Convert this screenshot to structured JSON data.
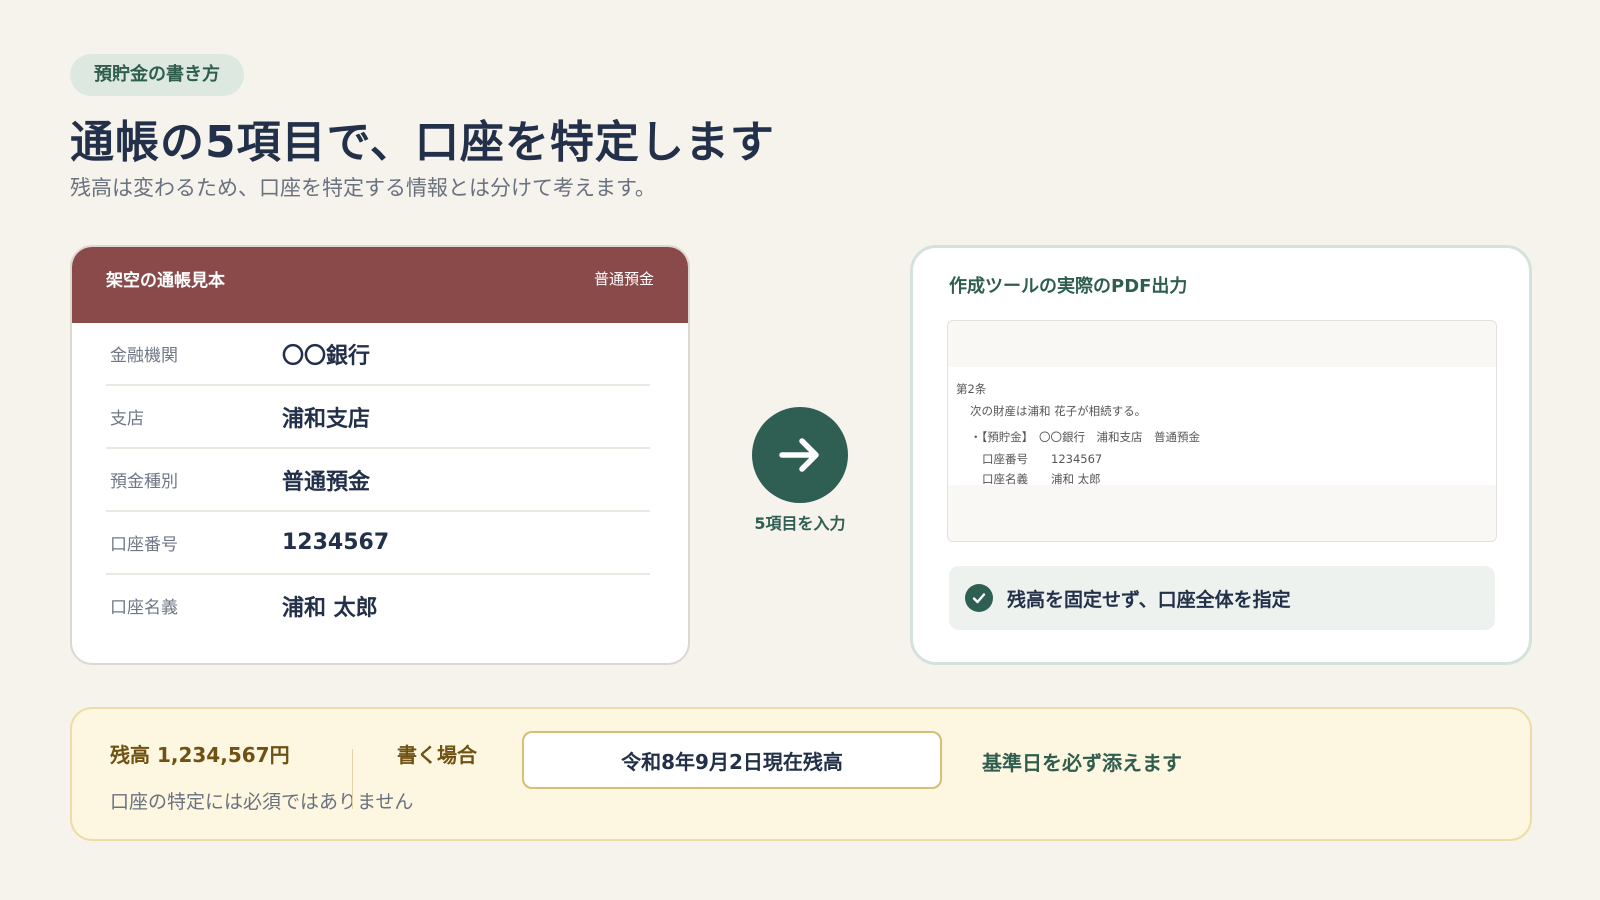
{
  "header": {
    "badge": "預貯金の書き方",
    "title": "通帳の5項目で、口座を特定します",
    "subtitle": "残高は変わるため、口座を特定する情報とは分けて考えます。"
  },
  "passbook": {
    "title": "架空の通帳見本",
    "type_tag": "普通預金",
    "header_color": "#8b4a4a",
    "rows": [
      {
        "label": "金融機関",
        "value": "〇〇銀行"
      },
      {
        "label": "支店",
        "value": "浦和支店"
      },
      {
        "label": "預金種別",
        "value": "普通預金"
      },
      {
        "label": "口座番号",
        "value": "1234567"
      },
      {
        "label": "口座名義",
        "value": "浦和 太郎"
      }
    ]
  },
  "flow": {
    "icon": "arrow-right-icon",
    "label": "5項目を入力",
    "color": "#2f5e52"
  },
  "output": {
    "title": "作成ツールの実際のPDF出力",
    "pdf_lines": [
      "第2条",
      "次の財産は浦和 花子が相続する。",
      "・【預貯金】　〇〇銀行　浦和支店　普通預金",
      "口座番号　　1234567",
      "口座名義　　浦和 太郎"
    ],
    "check_text": "残高を固定せず、口座全体を指定",
    "check_icon": "check-circle-icon"
  },
  "note": {
    "balance": "残高 1,234,567円",
    "balance_note": "口座の特定には必須ではありません",
    "write_label": "書く場合",
    "example": "令和8年9月2日現在残高",
    "tail": "基準日を必ず添えます"
  }
}
